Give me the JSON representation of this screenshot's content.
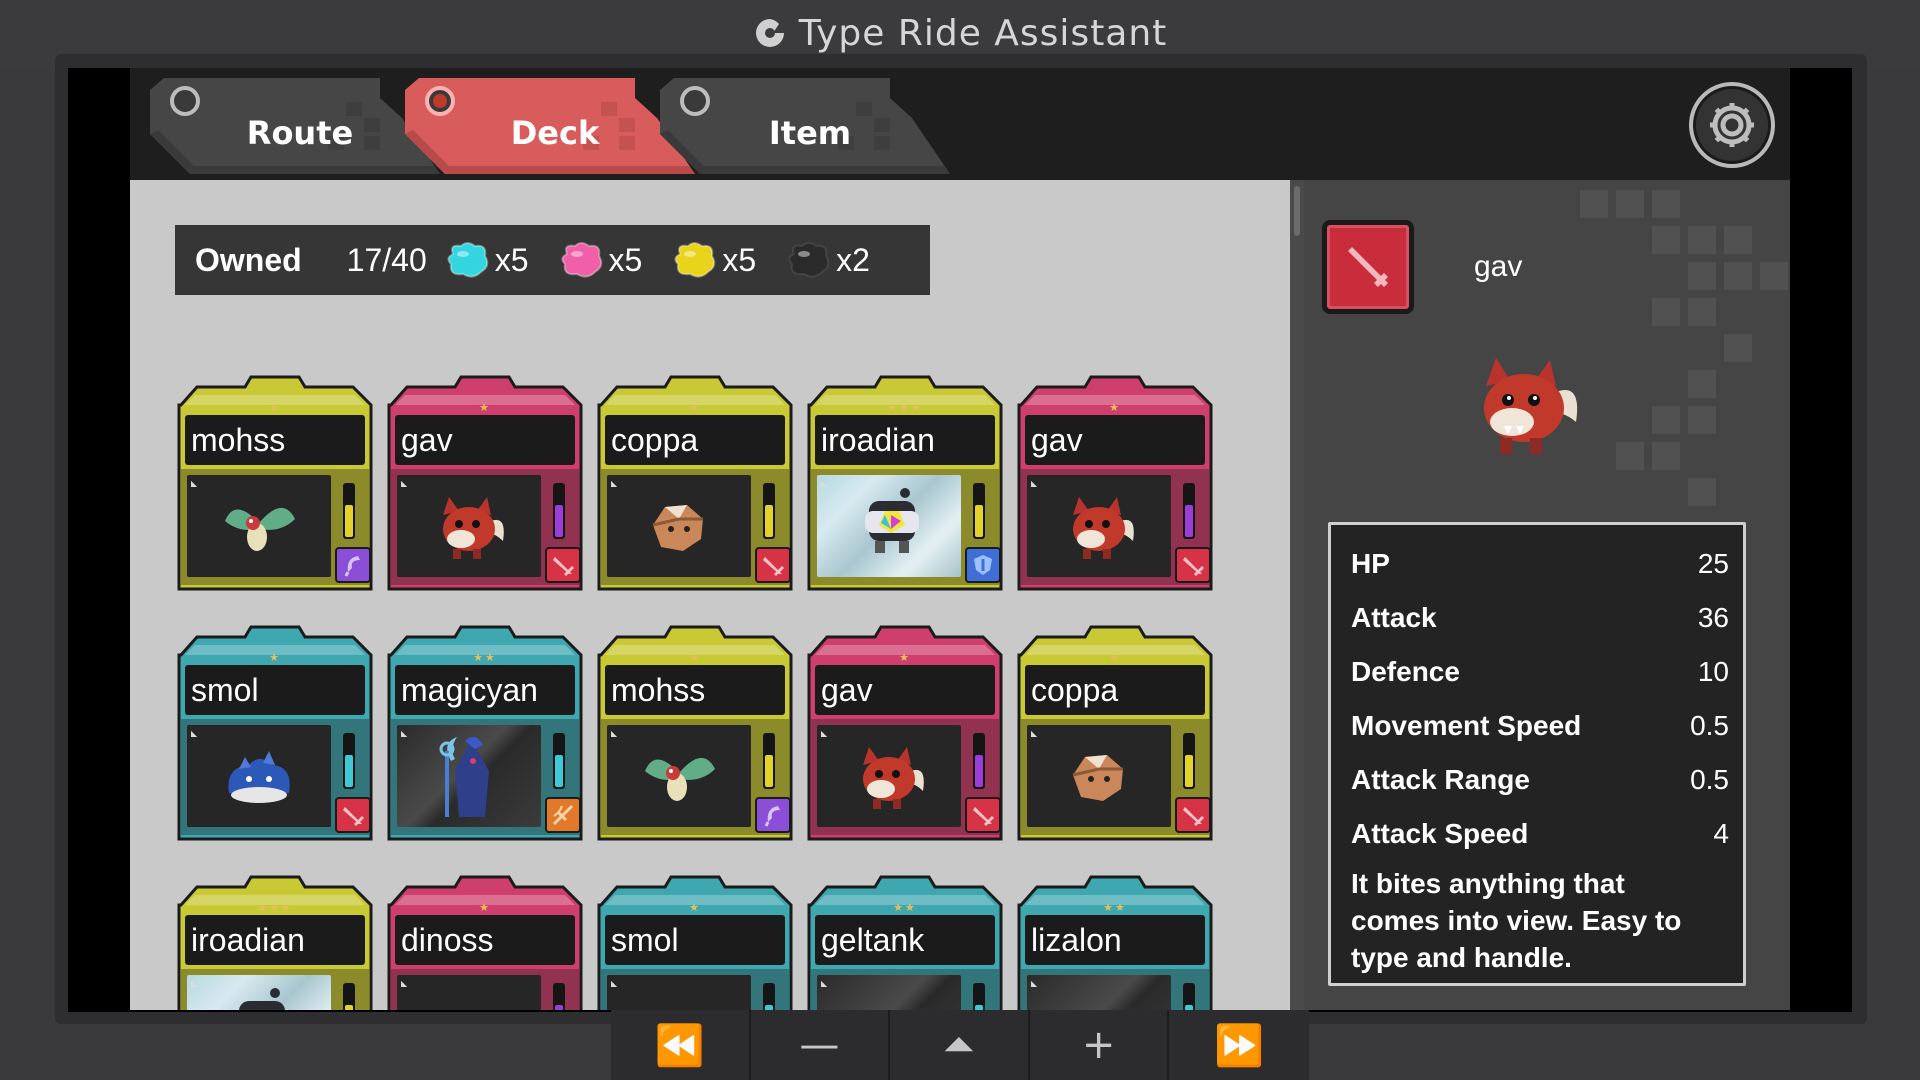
{
  "app": {
    "title": "Type Ride Assistant"
  },
  "tabs": [
    {
      "label": "Route",
      "active": false,
      "color": "#444444"
    },
    {
      "label": "Deck",
      "active": true,
      "color": "#d65a5a"
    },
    {
      "label": "Item",
      "active": false,
      "color": "#444444"
    }
  ],
  "owned": {
    "label": "Owned",
    "count": "17/40",
    "gems": [
      {
        "color": "#33d6e0",
        "count": "x5",
        "name": "cyan-gem-icon"
      },
      {
        "color": "#f060a8",
        "count": "x5",
        "name": "pink-gem-icon"
      },
      {
        "color": "#e8d41a",
        "count": "x5",
        "name": "yellow-gem-icon"
      },
      {
        "color": "#2a2a2a",
        "count": "x2",
        "name": "black-gem-icon"
      }
    ]
  },
  "cards": [
    {
      "name": "mohss",
      "frame": "#c9c835",
      "stars": "★",
      "type": "purple",
      "badge": "#8a4fd6",
      "energy": "#e3d22a",
      "art": "plain",
      "creature": "moth"
    },
    {
      "name": "gav",
      "frame": "#cf3f6e",
      "stars": "★",
      "type": "red",
      "badge": "#d73347",
      "energy": "#9a3fd6",
      "art": "plain",
      "creature": "fox"
    },
    {
      "name": "coppa",
      "frame": "#c9c835",
      "stars": "★",
      "type": "red",
      "badge": "#d73347",
      "energy": "#e3d22a",
      "art": "plain",
      "creature": "rock"
    },
    {
      "name": "iroadian",
      "frame": "#c9c835",
      "stars": "★★★",
      "type": "blue",
      "badge": "#3d6fd6",
      "energy": "#e3d22a",
      "art": "holo",
      "creature": "robot"
    },
    {
      "name": "gav",
      "frame": "#cf3f6e",
      "stars": "★",
      "type": "red",
      "badge": "#d73347",
      "energy": "#9a3fd6",
      "art": "plain",
      "creature": "fox"
    },
    {
      "name": "smol",
      "frame": "#3fa7b0",
      "stars": "★",
      "type": "red",
      "badge": "#d73347",
      "energy": "#3fc9d6",
      "art": "plain",
      "creature": "blob"
    },
    {
      "name": "magicyan",
      "frame": "#3fa7b0",
      "stars": "★★",
      "type": "orange",
      "badge": "#e07a2a",
      "energy": "#3fc9d6",
      "art": "glass",
      "creature": "mage"
    },
    {
      "name": "mohss",
      "frame": "#c9c835",
      "stars": "★",
      "type": "purple",
      "badge": "#8a4fd6",
      "energy": "#e3d22a",
      "art": "plain",
      "creature": "moth"
    },
    {
      "name": "gav",
      "frame": "#cf3f6e",
      "stars": "★",
      "type": "red",
      "badge": "#d73347",
      "energy": "#9a3fd6",
      "art": "plain",
      "creature": "fox"
    },
    {
      "name": "coppa",
      "frame": "#c9c835",
      "stars": "★",
      "type": "red",
      "badge": "#d73347",
      "energy": "#e3d22a",
      "art": "plain",
      "creature": "rock"
    },
    {
      "name": "iroadian",
      "frame": "#c9c835",
      "stars": "★★★",
      "type": "blue",
      "badge": "#3d6fd6",
      "energy": "#e3d22a",
      "art": "holo",
      "creature": "robot"
    },
    {
      "name": "dinoss",
      "frame": "#cf3f6e",
      "stars": "★",
      "type": "red",
      "badge": "#d73347",
      "energy": "#9a3fd6",
      "art": "plain",
      "creature": "none"
    },
    {
      "name": "smol",
      "frame": "#3fa7b0",
      "stars": "★",
      "type": "red",
      "badge": "#d73347",
      "energy": "#3fc9d6",
      "art": "plain",
      "creature": "none"
    },
    {
      "name": "geltank",
      "frame": "#3fa7b0",
      "stars": "★★",
      "type": "red",
      "badge": "#d73347",
      "energy": "#3fc9d6",
      "art": "glass",
      "creature": "none"
    },
    {
      "name": "lizalon",
      "frame": "#3fa7b0",
      "stars": "★★",
      "type": "red",
      "badge": "#d73347",
      "energy": "#3fc9d6",
      "art": "glass",
      "creature": "none"
    }
  ],
  "detail": {
    "name": "gav",
    "badge_color": "#c92d3b",
    "stats": [
      {
        "label": "HP",
        "value": "25"
      },
      {
        "label": "Attack",
        "value": "36"
      },
      {
        "label": "Defence",
        "value": "10"
      },
      {
        "label": "Movement Speed",
        "value": "0.5"
      },
      {
        "label": "Attack Range",
        "value": "0.5"
      },
      {
        "label": "Attack Speed",
        "value": "4"
      }
    ],
    "description": "It bites anything that comes into view. Easy to type and handle."
  },
  "controls": [
    {
      "glyph": "⏪",
      "name": "rewind-button"
    },
    {
      "glyph": "—",
      "name": "minus-button"
    },
    {
      "glyph": "⏶",
      "name": "home-button"
    },
    {
      "glyph": "+",
      "name": "plus-button"
    },
    {
      "glyph": "⏩",
      "name": "fast-forward-button"
    }
  ]
}
